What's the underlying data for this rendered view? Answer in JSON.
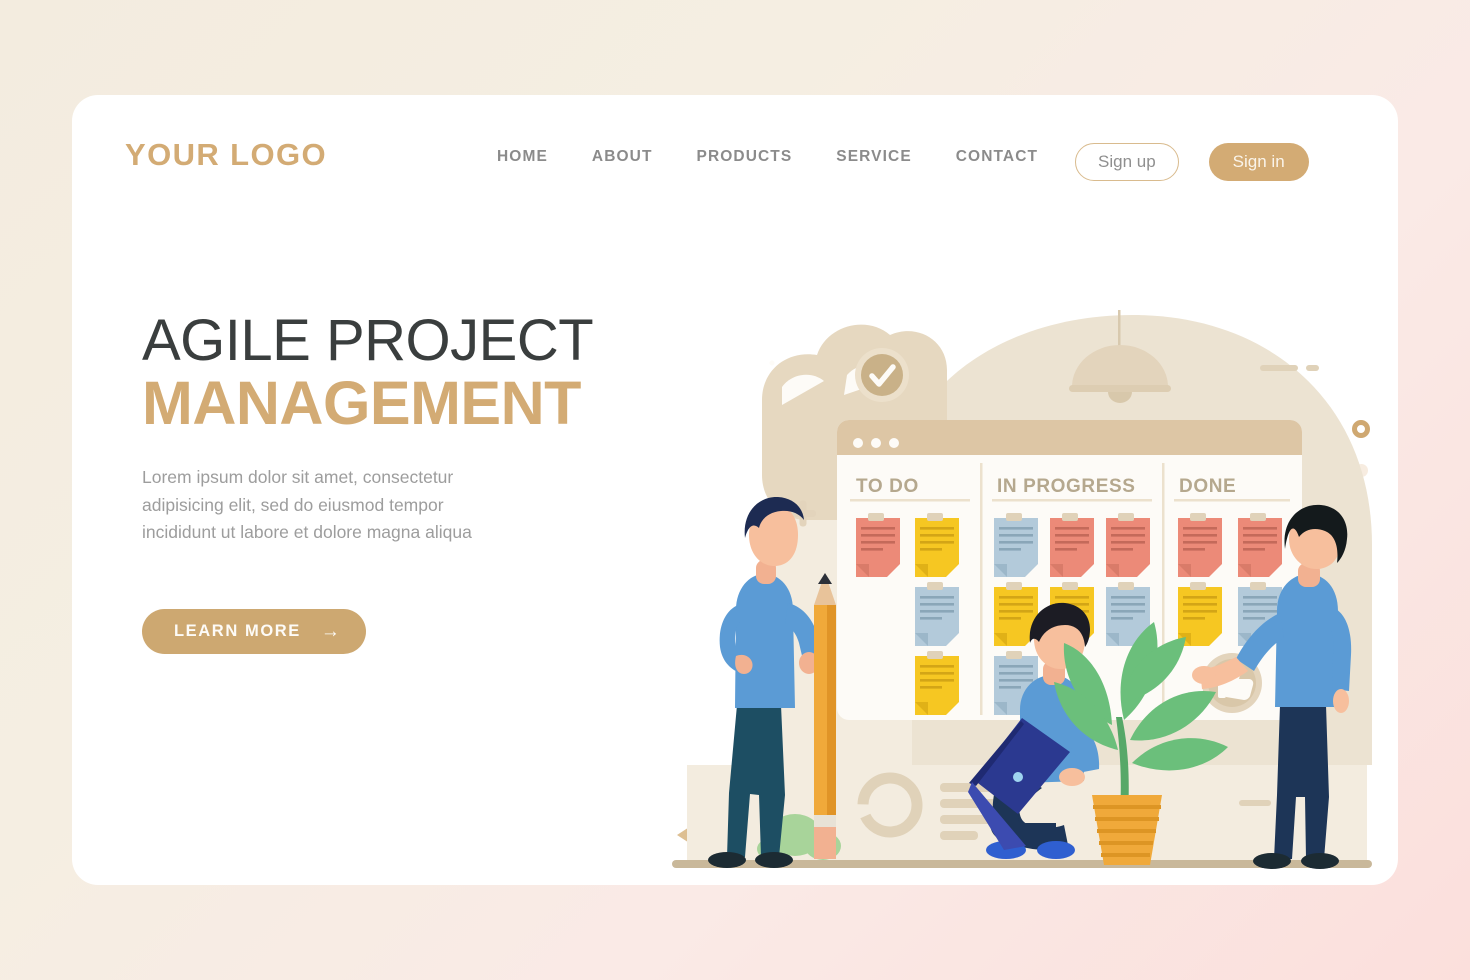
{
  "page": {
    "background_gradient_from": "#f3ecdf",
    "background_gradient_to": "#fbdfdc",
    "accent_color": "#d3ab74",
    "card_background": "#ffffff"
  },
  "header": {
    "logo": "YOUR LOGO",
    "nav": [
      {
        "label": "HOME"
      },
      {
        "label": "ABOUT"
      },
      {
        "label": "PRODUCTS"
      },
      {
        "label": "SERVICE"
      },
      {
        "label": "CONTACT"
      }
    ],
    "sign_up_label": "Sign up",
    "sign_in_label": "Sign in"
  },
  "hero": {
    "title_line1": "AGILE PROJECT",
    "title_line2": "MANAGEMENT",
    "subtitle": "Lorem ipsum dolor sit amet, consectetur adipisicing elit, sed do eiusmod tempor incididunt ut labore et dolore magna aliqua",
    "cta_label": "LEARN MORE",
    "cta_arrow": "→"
  },
  "carousel": {
    "prev_icon": "triangle-left-icon",
    "play_icon": "play-circle-icon",
    "dots": [
      {
        "active": true
      },
      {
        "active": false
      },
      {
        "active": false
      },
      {
        "active": false
      },
      {
        "active": false
      }
    ]
  },
  "illustration": {
    "board": {
      "window_dots": 3,
      "columns": [
        {
          "title": "TO DO"
        },
        {
          "title": "IN PROGRESS"
        },
        {
          "title": "DONE"
        }
      ],
      "note_colors": {
        "salmon": "#ec8a78",
        "yellow": "#f6c722",
        "blue": "#b3cada"
      },
      "notes": {
        "todo": [
          [
            "salmon",
            "yellow"
          ],
          [
            null,
            "blue"
          ],
          [
            null,
            "yellow"
          ]
        ],
        "in_progress": [
          [
            "blue",
            "salmon",
            "salmon"
          ],
          [
            "yellow",
            "yellow",
            "blue"
          ],
          [
            "blue",
            null,
            null
          ]
        ],
        "done": [
          [
            "salmon",
            "salmon"
          ],
          [
            "yellow",
            "blue"
          ]
        ]
      }
    },
    "badges": [
      {
        "name": "check-badge",
        "glyph": "✓"
      },
      {
        "name": "thumbs-up-badge",
        "glyph": "ὄD"
      }
    ],
    "characters": [
      {
        "name": "standing-man-with-pencil",
        "shirt": "#5b9bd5",
        "pants": "#1d4e63",
        "hair": "#1d2b52"
      },
      {
        "name": "seated-man-with-laptop",
        "shirt": "#5b9bd5",
        "pants": "#1d3557",
        "hair": "#1c1c24"
      },
      {
        "name": "man-at-board",
        "shirt": "#5b9bd5",
        "pants": "#1d3557",
        "hair": "#141a1c"
      }
    ],
    "props": [
      {
        "name": "pencil",
        "color": "#f0a93a"
      },
      {
        "name": "potted-plant",
        "leaf_color": "#6bbf7b",
        "pot_color": "#f0a93a"
      },
      {
        "name": "pendant-lamp",
        "color": "#e3d4bc"
      },
      {
        "name": "donut-chart",
        "color": "#ded0b9"
      },
      {
        "name": "bush",
        "color": "#a8d49a"
      }
    ]
  }
}
